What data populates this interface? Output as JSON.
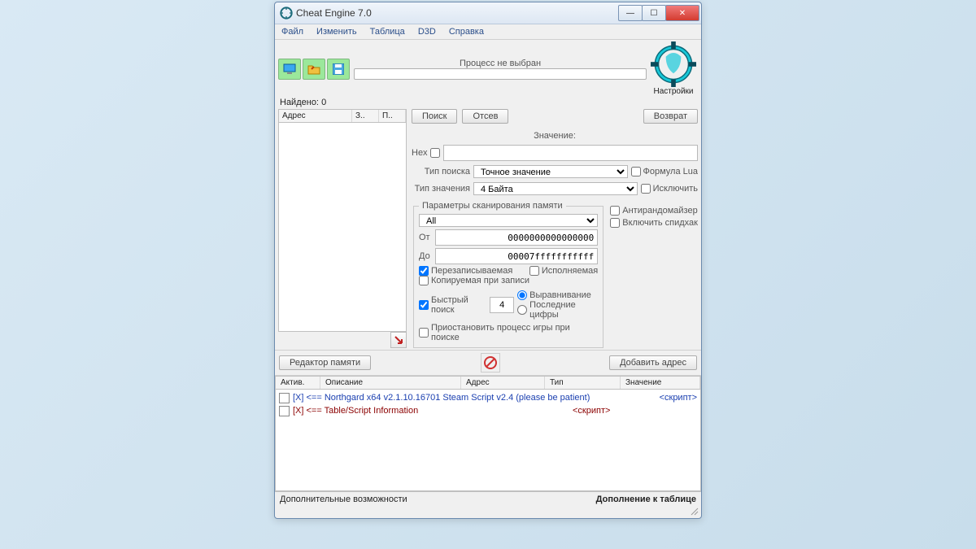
{
  "titlebar": {
    "title": "Cheat Engine 7.0"
  },
  "menu": {
    "file": "Файл",
    "edit": "Изменить",
    "table": "Таблица",
    "d3d": "D3D",
    "help": "Справка"
  },
  "process": {
    "status": "Процесс не выбран"
  },
  "found": {
    "label": "Найдено:",
    "count": "0"
  },
  "list_headers": {
    "address": "Адрес",
    "value": "З..",
    "prev": "П.."
  },
  "buttons": {
    "search": "Поиск",
    "filter": "Отсев",
    "undo": "Возврат",
    "memory_editor": "Редактор памяти",
    "add_address": "Добавить адрес"
  },
  "settings_label": "Настройки",
  "value_section": {
    "label": "Значение:",
    "hex": "Hex"
  },
  "search_type": {
    "label": "Тип поиска",
    "value": "Точное значение"
  },
  "value_type": {
    "label": "Тип значения",
    "value": "4 Байта"
  },
  "options": {
    "lua": "Формула Lua",
    "exclude": "Исключить",
    "antirand": "Антирандомайзер",
    "speedhack": "Включить спидхак"
  },
  "mem_params": {
    "legend": "Параметры сканирования памяти",
    "all": "All",
    "from_label": "От",
    "from_value": "0000000000000000",
    "to_label": "До",
    "to_value": "00007fffffffffff",
    "writable": "Перезаписываемая",
    "executable": "Исполняемая",
    "copy_on_write": "Копируемая при записи",
    "fast_scan": "Быстрый поиск",
    "fast_value": "4",
    "alignment": "Выравнивание",
    "last_digits": "Последние цифры",
    "pause": "Приостановить процесс игры при поиске"
  },
  "addr_table": {
    "headers": {
      "active": "Актив.",
      "desc": "Описание",
      "addr": "Адрес",
      "type": "Тип",
      "value": "Значение"
    },
    "rows": [
      {
        "desc": "[X] <== Northgard x64 v2.1.10.16701 Steam Script v2.4 (please be patient)",
        "value": "<скрипт>",
        "color": "blue"
      },
      {
        "desc": "[X] <== Table/Script Information",
        "value": "<скрипт>",
        "color": "darkred"
      }
    ]
  },
  "statusbar": {
    "left": "Дополнительные возможности",
    "right": "Дополнение к таблице"
  }
}
